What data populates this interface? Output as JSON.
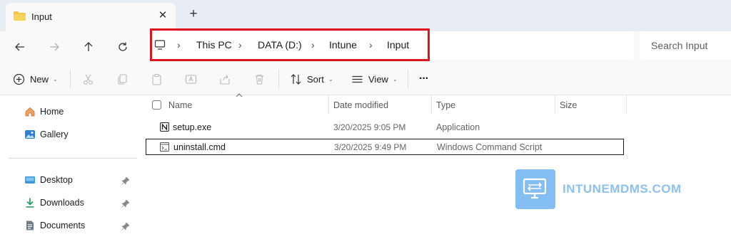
{
  "tab": {
    "title": "Input",
    "close_glyph": "✕",
    "new_tab_glyph": "+"
  },
  "nav": {
    "back_icon": "arrow-left-icon",
    "forward_icon": "arrow-right-icon",
    "up_icon": "arrow-up-icon",
    "refresh_icon": "refresh-icon"
  },
  "address": {
    "crumbs": [
      "This PC",
      "DATA (D:)",
      "Intune",
      "Input"
    ],
    "separator": "›"
  },
  "search": {
    "placeholder": "Search Input"
  },
  "commands": {
    "new_label": "New",
    "sort_label": "Sort",
    "view_label": "View",
    "more_label": "···",
    "caret": "⌄"
  },
  "sidebar": {
    "items": [
      {
        "label": "Home",
        "icon": "home-icon"
      },
      {
        "label": "Gallery",
        "icon": "gallery-icon"
      },
      {
        "label": "Desktop",
        "icon": "desktop-icon",
        "pinned": true
      },
      {
        "label": "Downloads",
        "icon": "download-icon",
        "pinned": true
      },
      {
        "label": "Documents",
        "icon": "documents-icon",
        "pinned": true
      }
    ]
  },
  "columns": [
    "Name",
    "Date modified",
    "Type",
    "Size"
  ],
  "files": [
    {
      "name": "setup.exe",
      "date": "3/20/2025 9:05 PM",
      "type": "Application",
      "size": ""
    },
    {
      "name": "uninstall.cmd",
      "date": "3/20/2025 9:49 PM",
      "type": "Windows Command Script",
      "size": ""
    }
  ],
  "watermark": {
    "text": "INTUNEMDMS.COM"
  },
  "colors": {
    "highlight": "#e0141e",
    "watermark": "#7ab8f2",
    "folder": "#f4c542"
  }
}
